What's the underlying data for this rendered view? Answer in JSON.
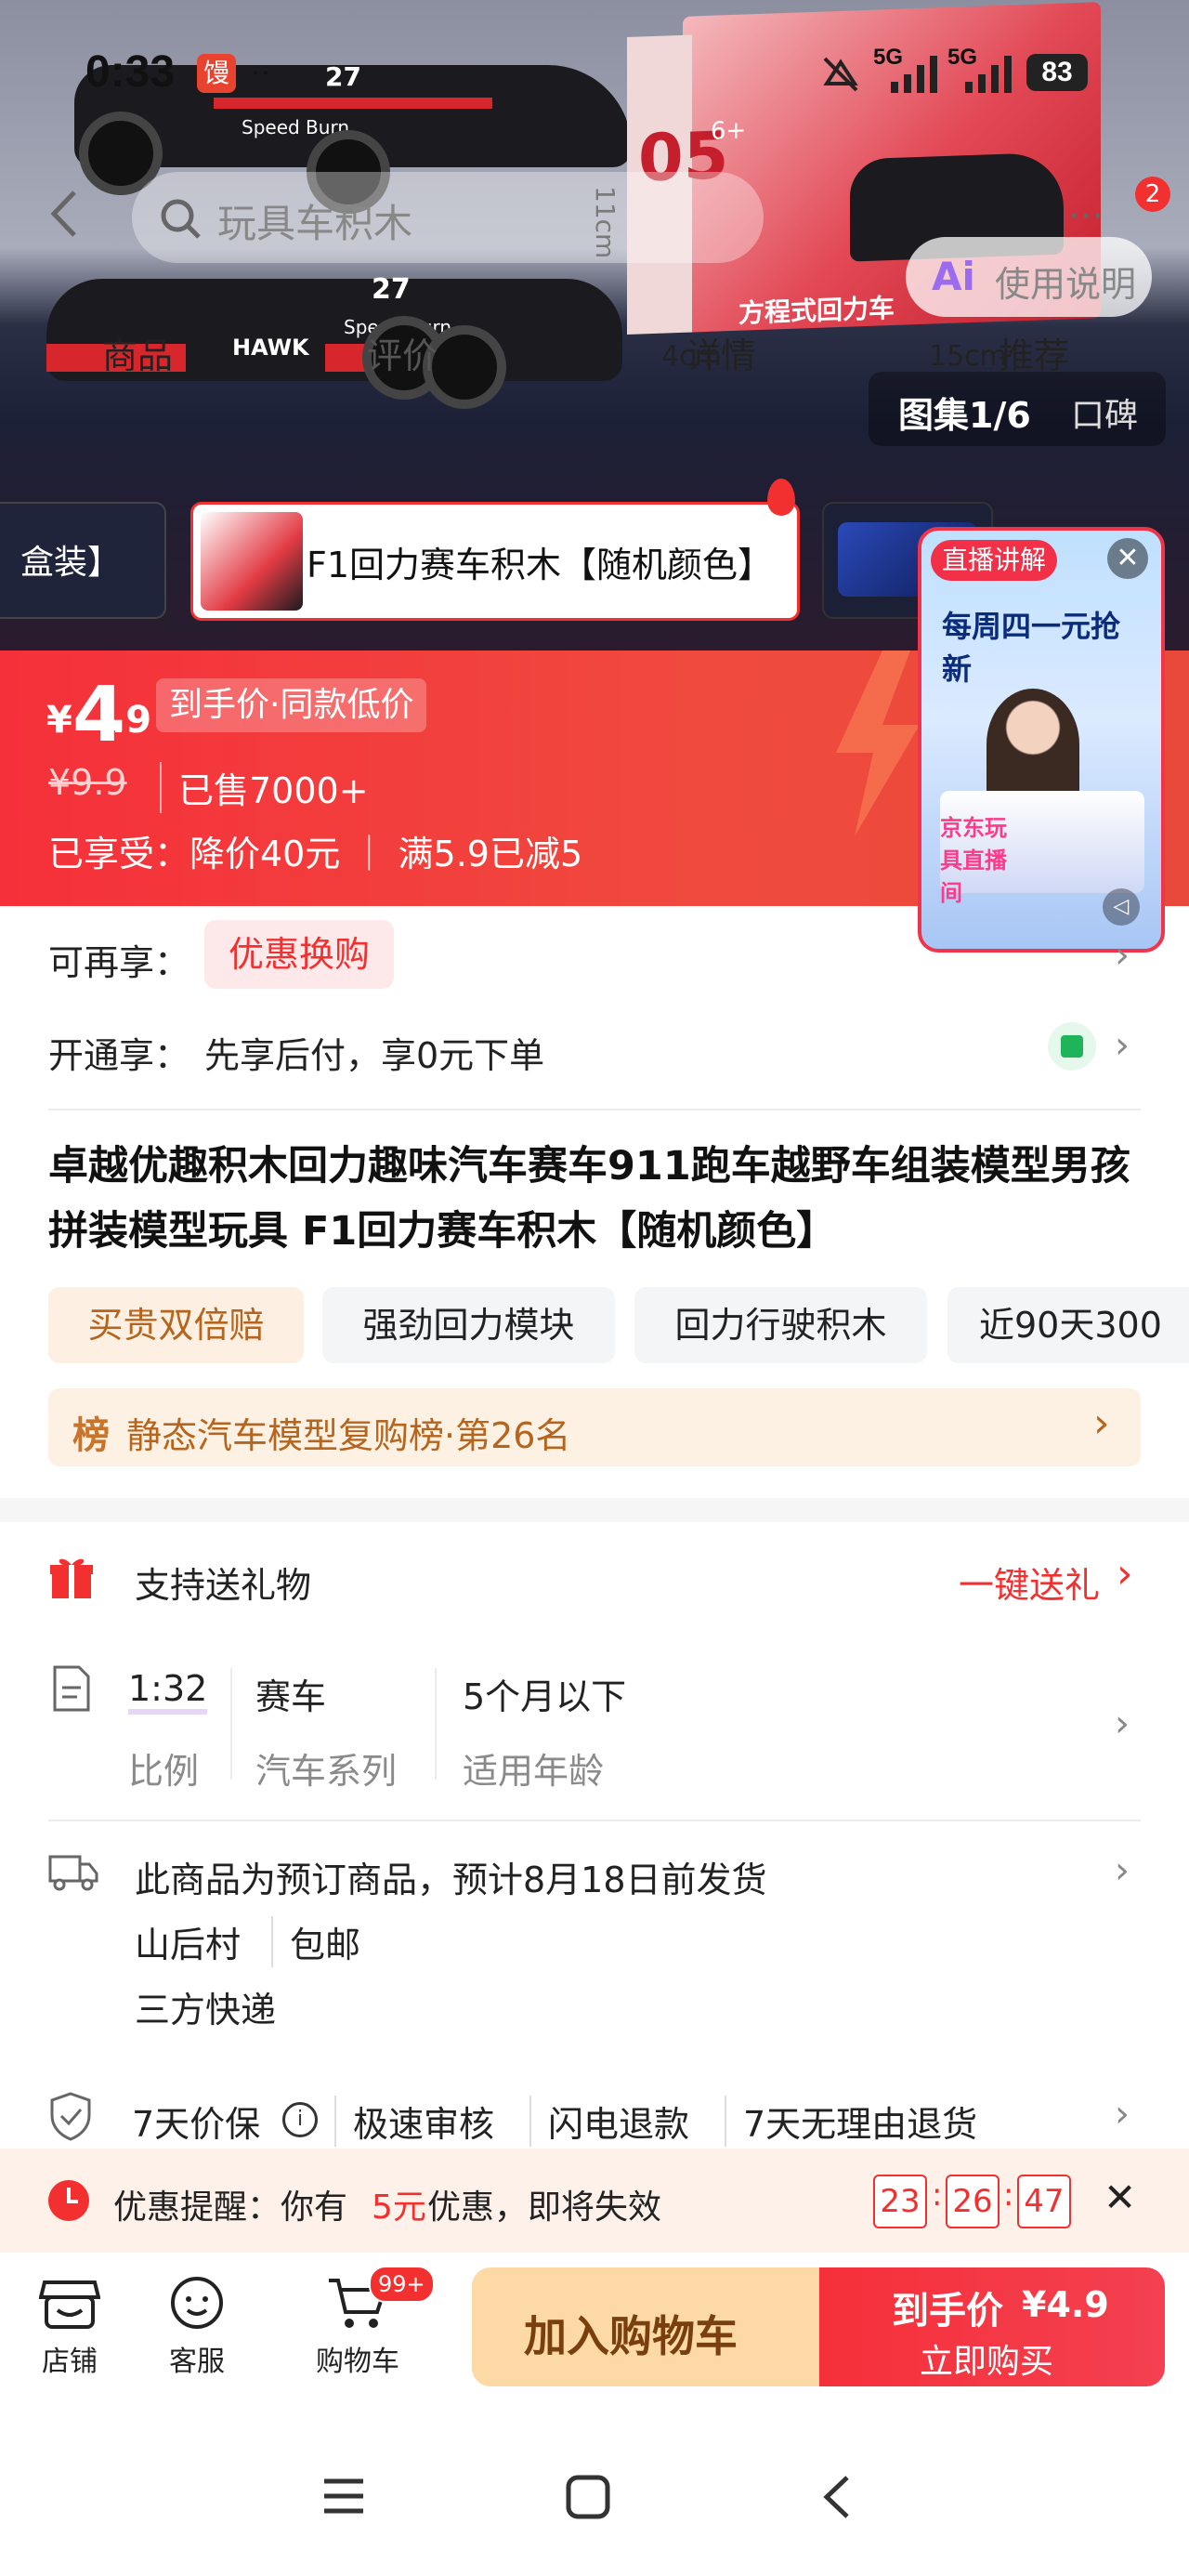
{
  "status_bar": {
    "time": "0:33",
    "network_1": "5G",
    "network_2": "5G",
    "battery": "83"
  },
  "header": {
    "search_placeholder": "玩具车积木",
    "cart_badge": "2",
    "help_label": "使用说明"
  },
  "nav_tabs": [
    {
      "label": "商品"
    },
    {
      "label": "详情"
    },
    {
      "label": "评价"
    },
    {
      "label": "推荐"
    }
  ],
  "gallery": {
    "counter": "图集1/6",
    "reviews_label": "口碑"
  },
  "hero_box": {
    "dim_h": "11cm",
    "dim_w": "4cm",
    "dim_l": "15cm",
    "box_text": "方程式回力车",
    "box_num": "05",
    "box_age": "6+",
    "car_logo": "HAWK",
    "car_text": "Speed Burn",
    "car_number": "27"
  },
  "variants": [
    {
      "label": "盒装】"
    },
    {
      "label": "F1回力赛车积木【随机颜色】"
    }
  ],
  "price": {
    "symbol": "¥",
    "integer": "4",
    "decimal": ".9",
    "tag": "到手价·同款低价",
    "original": "¥9.9",
    "sold": "已售7000+",
    "enjoyed": "已享受：降价40元 ｜ 满5.9已减5"
  },
  "live": {
    "badge": "直播讲解",
    "headline": "每周四一元抢新",
    "sub": "京东玩具直播间"
  },
  "promo_rows": [
    {
      "label": "可再享：",
      "chip": "优惠换购"
    },
    {
      "label": "开通享：",
      "text": "先享后付，享0元下单"
    }
  ],
  "product_title": "卓越优趣积木回力趣味汽车赛车911跑车越野车组装模型男孩拼装模型玩具 F1回力赛车积木【随机颜色】",
  "tags": [
    "买贵双倍赔",
    "强劲回力模块",
    "回力行驶积木",
    "近90天300"
  ],
  "ranking": {
    "icon": "榜",
    "text": "静态汽车模型复购榜·第26名"
  },
  "gift": {
    "label": "支持送礼物",
    "action": "一键送礼"
  },
  "specs": [
    {
      "value": "1:32",
      "name": "比例"
    },
    {
      "value": "赛车",
      "name": "汽车系列"
    },
    {
      "value": "5个月以下",
      "name": "适用年龄"
    }
  ],
  "shipping": {
    "line1": "此商品为预订商品，预计8月18日前发货",
    "location": "山后村",
    "free": "包邮",
    "carrier": "三方快递"
  },
  "guarantees": [
    "7天价保",
    "极速审核",
    "闪电退款",
    "7天无理由退货"
  ],
  "alert": {
    "prefix": "优惠提醒：你有",
    "amount": "5元",
    "suffix": "优惠，即将失效",
    "hh": "23",
    "mm": "26",
    "ss": "47"
  },
  "bottom": {
    "shop": "店铺",
    "service": "客服",
    "cart": "购物车",
    "cart_badge": "99+",
    "add_cart": "加入购物车",
    "buy_price_label": "到手价",
    "buy_price": "¥4.9",
    "buy_now": "立即购买"
  },
  "colors": {
    "brand_red": "#f5303a",
    "accent_orange": "#b5651d",
    "chip_pink": "#fde8ea",
    "cart_btn": "#fcd9a5"
  }
}
